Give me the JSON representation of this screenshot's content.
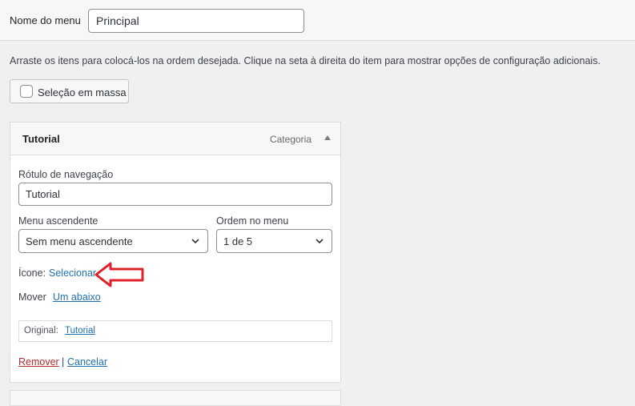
{
  "menu": {
    "name_label": "Nome do menu",
    "name_value": "Principal"
  },
  "instructions": "Arraste os itens para colocá-los na ordem desejada. Clique na seta à direita do item para mostrar opções de configuração adicionais.",
  "bulk_select": {
    "label": "Seleção em massa"
  },
  "item": {
    "title": "Tutorial",
    "type": "Categoria",
    "nav_label": {
      "label": "Rótulo de navegação",
      "value": "Tutorial"
    },
    "parent": {
      "label": "Menu ascendente",
      "value": "Sem menu ascendente"
    },
    "order": {
      "label": "Ordem no menu",
      "value": "1 de 5"
    },
    "icon": {
      "label": "Ícone:",
      "link": "Selecionar"
    },
    "move": {
      "label": "Mover",
      "link": "Um abaixo"
    },
    "original": {
      "label": "Original:",
      "link": "Tutorial"
    },
    "actions": {
      "remove": "Remover",
      "separator": "|",
      "cancel": "Cancelar"
    }
  },
  "colors": {
    "link": "#2271b1",
    "danger": "#b32d2e",
    "annotation_arrow": "#e0202a"
  }
}
